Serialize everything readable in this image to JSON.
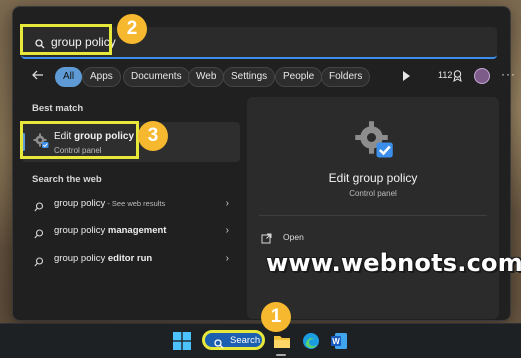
{
  "search": {
    "query": "group policy"
  },
  "filters": {
    "chips": [
      "All",
      "Apps",
      "Documents",
      "Web",
      "Settings",
      "People",
      "Folders"
    ],
    "active": "All",
    "reward_count": "112"
  },
  "best_match": {
    "heading": "Best match",
    "title_prefix": "Edit ",
    "title_bold": "group policy",
    "subtitle": "Control panel"
  },
  "web": {
    "heading": "Search the web",
    "rows": [
      {
        "text": "group policy",
        "suffix": " - See web results",
        "bold": ""
      },
      {
        "text": "group policy ",
        "suffix": "",
        "bold": "management"
      },
      {
        "text": "group policy ",
        "suffix": "",
        "bold": "editor run"
      }
    ]
  },
  "preview": {
    "title": "Edit group policy",
    "subtitle": "Control panel",
    "open_label": "Open"
  },
  "annotations": {
    "badge_1": "1",
    "badge_2": "2",
    "badge_3": "3",
    "highlight_color": "#e6e83a",
    "badge_color": "#f5b82e"
  },
  "watermark": "www.webnots.com",
  "taskbar": {
    "search_label": "Search",
    "apps": [
      "start-icon",
      "file-explorer-icon",
      "edge-icon",
      "word-icon"
    ]
  },
  "colors": {
    "accent": "#5e9bd6",
    "panel_bg": "#202020"
  }
}
